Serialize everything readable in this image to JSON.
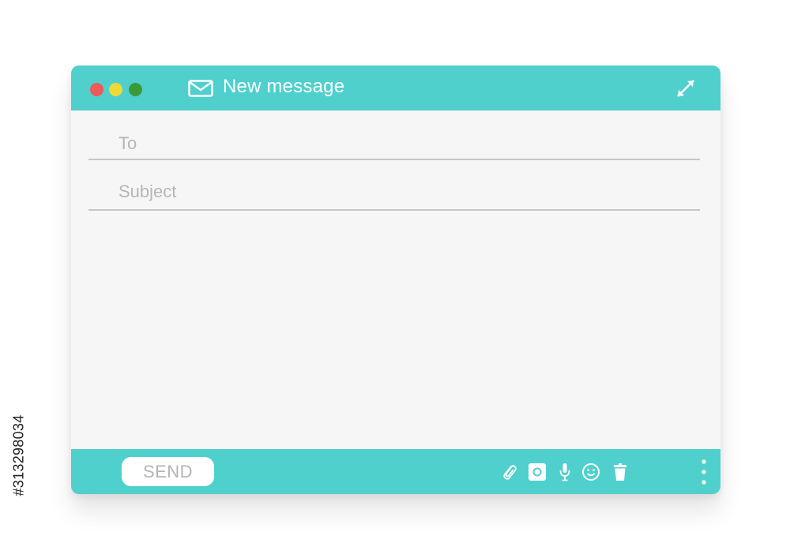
{
  "window": {
    "title": "New message",
    "title_icon": "envelope-icon",
    "expand_icon": "expand-arrows-icon",
    "traffic_lights": [
      {
        "name": "close",
        "color": "#ef5a5a"
      },
      {
        "name": "minimize",
        "color": "#f0d835"
      },
      {
        "name": "maximize",
        "color": "#3a9a3a"
      }
    ],
    "accent_color": "#4fd0cd"
  },
  "form": {
    "to_label": "To",
    "subject_label": "Subject",
    "body": ""
  },
  "footer": {
    "send_label": "SEND",
    "tools": [
      "paperclip-icon",
      "camera-icon",
      "microphone-icon",
      "emoji-icon",
      "trash-icon"
    ],
    "more_icon": "vertical-ellipsis-icon"
  },
  "watermark": {
    "id_text": "#313298034"
  }
}
